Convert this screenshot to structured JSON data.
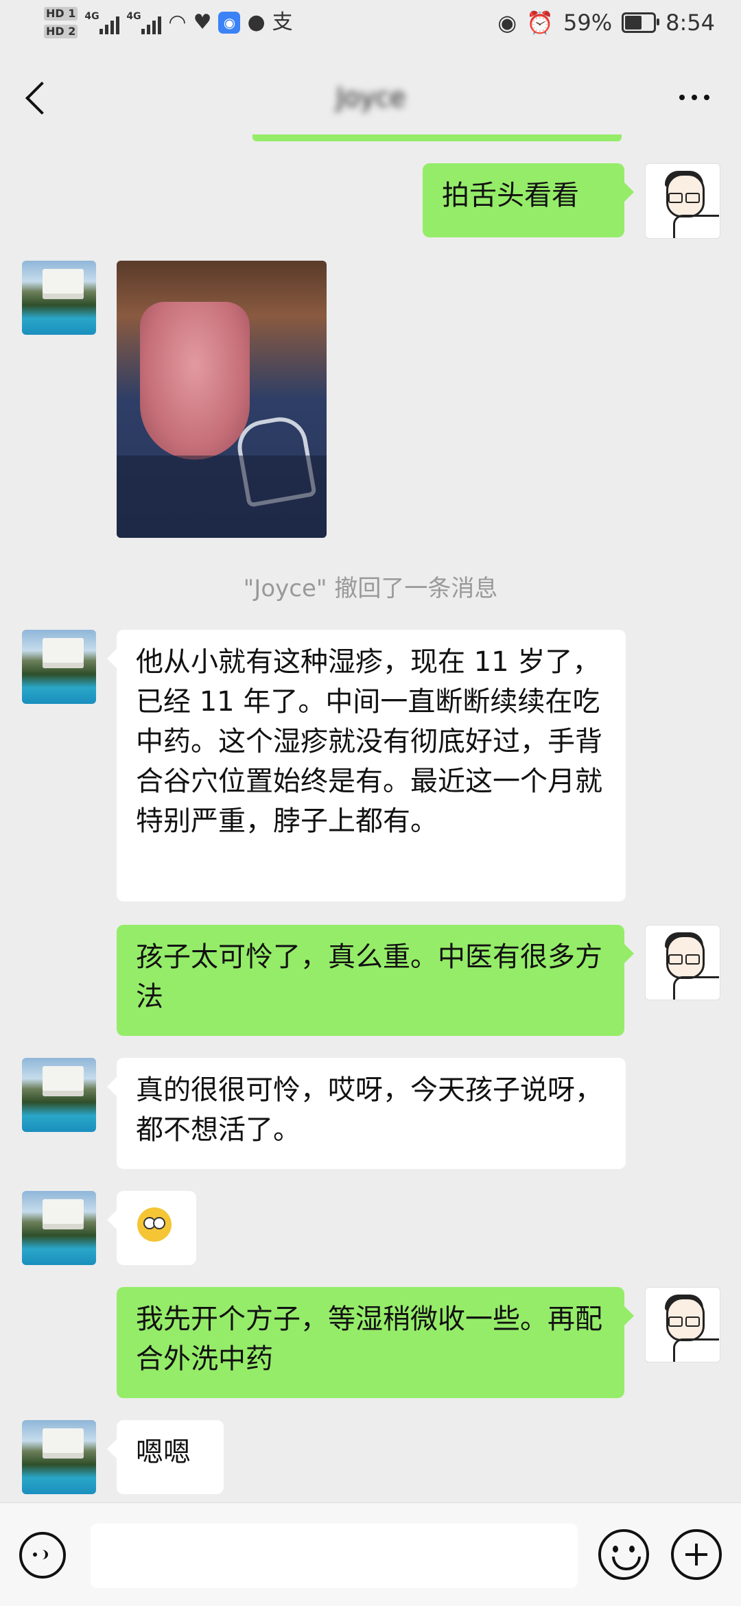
{
  "status_bar": {
    "hd1": "HD 1",
    "hd2": "HD 2",
    "net1": "4G",
    "net2": "4G",
    "alipay_glyph": "支",
    "battery": "59%",
    "time": "8:54",
    "icons": [
      "signal-icon",
      "wifi-icon",
      "health-icon",
      "app-badge-icon",
      "qq-icon",
      "alipay-icon",
      "eye-icon",
      "alarm-icon",
      "battery-icon"
    ]
  },
  "header": {
    "title": "Joyce"
  },
  "messages": [
    {
      "side": "out",
      "type": "text",
      "text": "拍舌头看看"
    },
    {
      "side": "in",
      "type": "image",
      "text": ""
    },
    {
      "side": "system",
      "type": "recall",
      "text": "\"Joyce\" 撤回了一条消息"
    },
    {
      "side": "in",
      "type": "text",
      "text": "他从小就有这种湿疹，现在 11 岁了，已经 11 年了。中间一直断断续续在吃中药。这个湿疹就没有彻底好过，手背合谷穴位置始终是有。最近这一个月就特别严重，脖子上都有。"
    },
    {
      "side": "out",
      "type": "text",
      "text": "孩子太可怜了，真么重。中医有很多方法"
    },
    {
      "side": "in",
      "type": "text",
      "text": "真的很很可怜，哎呀，今天孩子说呀，都不想活了。"
    },
    {
      "side": "in",
      "type": "emoji",
      "text": "🥺"
    },
    {
      "side": "out",
      "type": "text",
      "text": "我先开个方子，等湿稍微收一些。再配合外洗中药"
    },
    {
      "side": "in",
      "type": "text",
      "text": "嗯嗯"
    }
  ],
  "input": {
    "value": "",
    "placeholder": ""
  },
  "colors": {
    "background": "#ededed",
    "bubble_out": "#95ec69",
    "bubble_in": "#ffffff"
  }
}
